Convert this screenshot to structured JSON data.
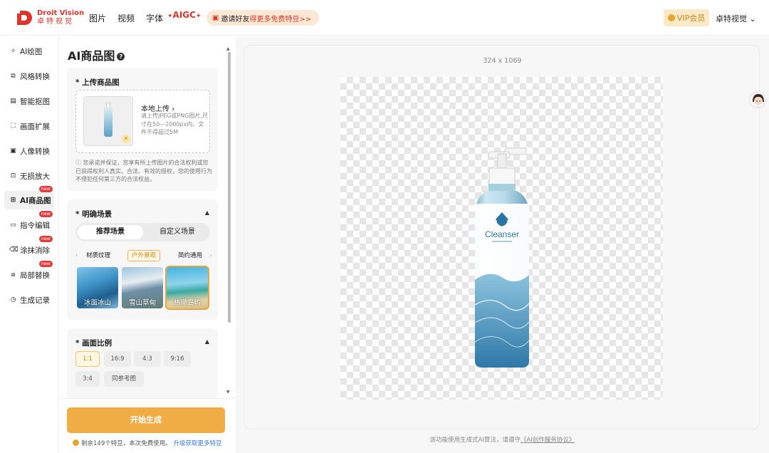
{
  "header": {
    "logo_en": "Droit Vision",
    "logo_cn": "卓特视觉",
    "nav": [
      "图片",
      "视频",
      "字体"
    ],
    "aigc": "AIGC",
    "invite_prefix": "邀请好友",
    "invite_highlight": "得更多免费特豆>>",
    "vip_label": "VIP会员",
    "user_name": "卓特视觉"
  },
  "sidebar": {
    "items": [
      {
        "label": "AI绘图",
        "icon": "magic-wand-icon"
      },
      {
        "label": "风格转换",
        "icon": "style-convert-icon"
      },
      {
        "label": "智能抠图",
        "icon": "cutout-icon"
      },
      {
        "label": "画面扩展",
        "icon": "expand-icon"
      },
      {
        "label": "人像转换",
        "icon": "portrait-icon"
      },
      {
        "label": "无损放大",
        "icon": "zoom-icon"
      },
      {
        "label": "AI商品图",
        "icon": "product-icon",
        "badge": "new",
        "active": true
      },
      {
        "label": "指令编辑",
        "icon": "edit-icon",
        "badge": "new"
      },
      {
        "label": "涂抹消除",
        "icon": "eraser-icon",
        "badge": "new"
      },
      {
        "label": "局部替换",
        "icon": "replace-icon",
        "badge": "new"
      },
      {
        "label": "生成记录",
        "icon": "history-icon"
      }
    ]
  },
  "panel": {
    "title": "AI商品图",
    "upload": {
      "title": "* 上传商品图",
      "local_upload": "本地上传",
      "desc": "请上传JPEG或PNG图片,尺寸在50—2000px内、文件不得超过5M",
      "notice": "您承诺并保证，您享有所上传图片的合法权利或您已获得权利人真实、合法、有效的授权，您的使用行为不侵犯任何第三方的合法权益。"
    },
    "scene": {
      "title": "* 明确场景",
      "tabs": [
        "推荐场景",
        "自定义场景"
      ],
      "subtabs": [
        "材质纹理",
        "户外景观",
        "简约通用"
      ],
      "selected_subtab": "户外景观",
      "options": [
        "冰面冰山",
        "雪山草甸",
        "热带岛屿"
      ],
      "selected_option": "热带岛屿"
    },
    "ratio": {
      "title": "* 画面比例",
      "options": [
        "1:1",
        "16:9",
        "4:3",
        "9:16",
        "3:4",
        "同参考图"
      ],
      "selected": "1:1"
    },
    "generate_label": "开始生成",
    "quota_text": "剩余149个特豆，本次免费使用。",
    "quota_link": "升级获取更多特豆"
  },
  "canvas": {
    "dimensions": "324 x 1069",
    "product_label": "Cleanser",
    "footnote_prefix": "该功能使用生成式AI算法，请遵守",
    "footnote_link": "《AI创作服务协议》"
  },
  "colors": {
    "accent": "#f0ac45",
    "brand": "#e0342b",
    "link": "#3a7be0"
  }
}
